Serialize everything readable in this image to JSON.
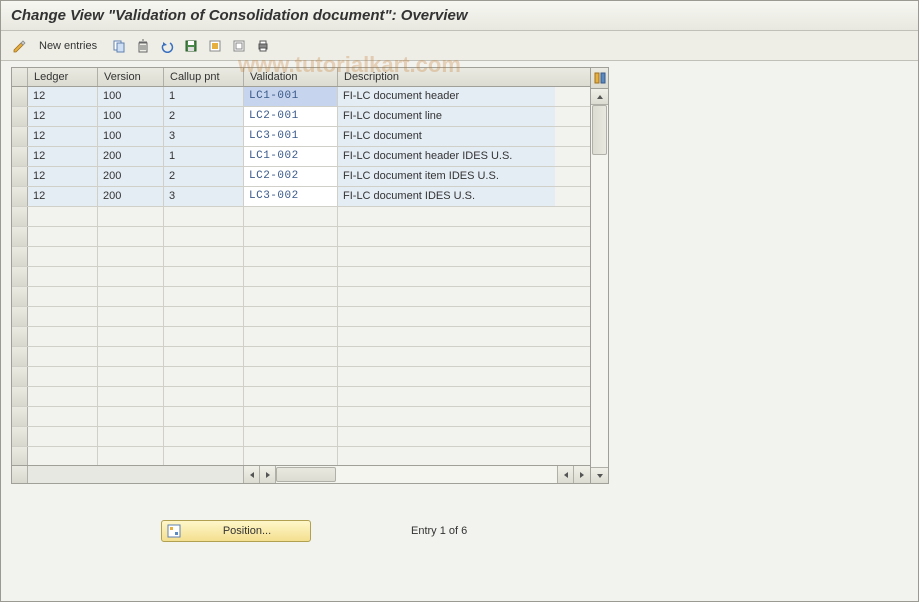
{
  "title": "Change View \"Validation of Consolidation document\": Overview",
  "toolbar": {
    "new_entries": "New entries"
  },
  "columns": {
    "ledger": "Ledger",
    "version": "Version",
    "callup": "Callup pnt",
    "validation": "Validation",
    "description": "Description"
  },
  "rows": [
    {
      "ledger": "12",
      "version": "100",
      "callup": "1",
      "validation": "LC1-001",
      "description": "FI-LC document header"
    },
    {
      "ledger": "12",
      "version": "100",
      "callup": "2",
      "validation": "LC2-001",
      "description": "FI-LC document line"
    },
    {
      "ledger": "12",
      "version": "100",
      "callup": "3",
      "validation": "LC3-001",
      "description": "FI-LC document"
    },
    {
      "ledger": "12",
      "version": "200",
      "callup": "1",
      "validation": "LC1-002",
      "description": "FI-LC document header IDES U.S."
    },
    {
      "ledger": "12",
      "version": "200",
      "callup": "2",
      "validation": "LC2-002",
      "description": "FI-LC document item IDES U.S."
    },
    {
      "ledger": "12",
      "version": "200",
      "callup": "3",
      "validation": "LC3-002",
      "description": "FI-LC document IDES U.S."
    }
  ],
  "footer": {
    "position": "Position...",
    "status": "Entry 1 of 6"
  },
  "watermark": "www.tutorialkart.com"
}
